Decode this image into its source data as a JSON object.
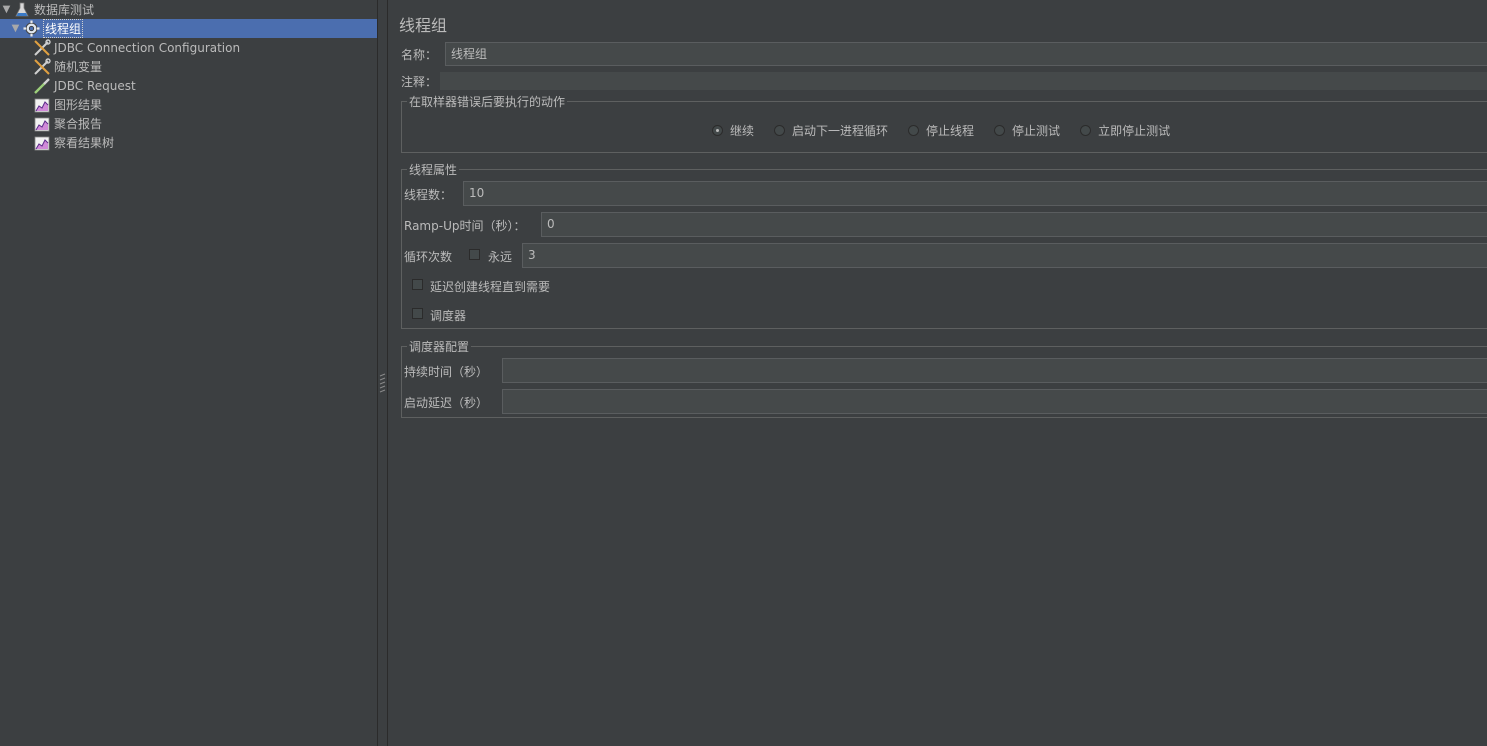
{
  "tree": {
    "items": [
      {
        "label": "数据库测试",
        "icon": "testplan-flask-icon"
      },
      {
        "label": "线程组",
        "icon": "gear-icon"
      },
      {
        "label": "JDBC Connection Configuration",
        "icon": "wrench-icon"
      },
      {
        "label": "随机变量",
        "icon": "wrench-icon"
      },
      {
        "label": "JDBC Request",
        "icon": "pipette-sampler-icon"
      },
      {
        "label": "图形结果",
        "icon": "chart-listener-icon"
      },
      {
        "label": "聚合报告",
        "icon": "chart-listener-icon"
      },
      {
        "label": "察看结果树",
        "icon": "chart-listener-icon"
      }
    ]
  },
  "main": {
    "title": "线程组",
    "name_label": "名称：",
    "name_value": "线程组",
    "comment_label": "注释：",
    "comment_value": "",
    "error_action": {
      "legend": "在取样器错误后要执行的动作",
      "options": [
        "继续",
        "启动下一进程循环",
        "停止线程",
        "停止测试",
        "立即停止测试"
      ],
      "selected": "继续"
    },
    "thread_props": {
      "legend": "线程属性",
      "threads_label": "线程数：",
      "threads_value": "10",
      "rampup_label": "Ramp-Up时间（秒）：",
      "rampup_value": "0",
      "loop_label": "循环次数",
      "forever_label": "永远",
      "forever_checked": false,
      "loop_value": "3",
      "delay_label": "延迟创建线程直到需要",
      "delay_checked": false,
      "scheduler_label": "调度器",
      "scheduler_checked": false
    },
    "scheduler_config": {
      "legend": "调度器配置",
      "duration_label": "持续时间（秒）",
      "duration_value": "",
      "startup_label": "启动延迟（秒）",
      "startup_value": ""
    }
  },
  "colors": {
    "background": "#3c3f41",
    "selection": "#4b6eaf",
    "field": "#45494a",
    "text": "#bbbbbb"
  }
}
